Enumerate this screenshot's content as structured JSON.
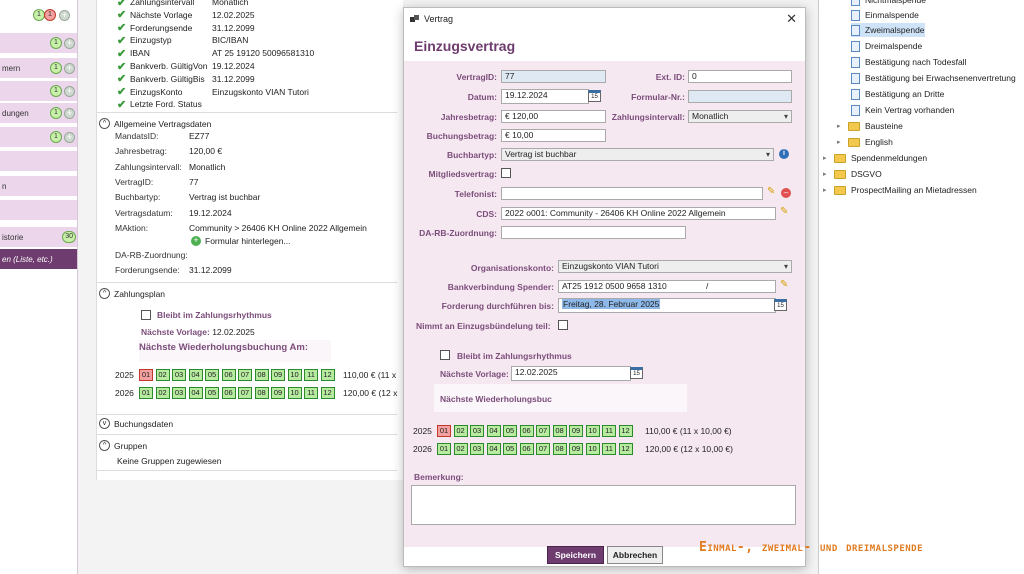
{
  "sidebar": {
    "badges": {
      "first": "1",
      "second": "1"
    },
    "items": [
      {
        "label": "",
        "count": "1"
      },
      {
        "label": "mern",
        "count": "1"
      },
      {
        "label": "",
        "count": "1"
      },
      {
        "label": "dungen",
        "count": "1"
      },
      {
        "label": "",
        "count": "1"
      },
      {
        "label": "",
        "count": ""
      },
      {
        "label": "n",
        "count": ""
      },
      {
        "label": "",
        "count": ""
      },
      {
        "label": "istorie",
        "count": "30"
      },
      {
        "label": "en (Liste, etc.)",
        "count": ""
      }
    ]
  },
  "contract_status": [
    {
      "label": "Zahlungsintervall",
      "value": "Monatlich"
    },
    {
      "label": "Nächste Vorlage",
      "value": "12.02.2025"
    },
    {
      "label": "Forderungsende",
      "value": "31.12.2099"
    },
    {
      "label": "Einzugstyp",
      "value": "BIC/IBAN"
    },
    {
      "label": "IBAN",
      "value": "AT 25 19120 50096581310"
    },
    {
      "label": "Bankverb. GültigVon",
      "value": "19.12.2024"
    },
    {
      "label": "Bankverb. GültigBis",
      "value": "31.12.2099"
    },
    {
      "label": "EinzugsKonto",
      "value": "Einzugskonto VIAN Tutori"
    },
    {
      "label": "Letzte Ford. Status",
      "value": ""
    }
  ],
  "general": {
    "title": "Allgemeine Vertragsdaten",
    "rows": [
      {
        "label": "MandatsID:",
        "value": "EZ77"
      },
      {
        "label": "Jahresbetrag:",
        "value": "120,00 €"
      },
      {
        "label": "Zahlungsintervall:",
        "value": "Monatlich"
      },
      {
        "label": "VertragID:",
        "value": "77"
      },
      {
        "label": "Buchbartyp:",
        "value": "Vertrag ist buchbar"
      },
      {
        "label": "Vertragsdatum:",
        "value": "19.12.2024"
      },
      {
        "label": "MAktion:",
        "value": "Community  >  26406 KH Online 2022 Allgemein"
      }
    ],
    "form_link": "Formular hinterlegen...",
    "rows2": [
      {
        "label": "DA-RB-Zuordnung:",
        "value": ""
      },
      {
        "label": "Forderungsende:",
        "value": "31.12.2099"
      }
    ]
  },
  "zahlungsplan": {
    "title": "Zahlungsplan",
    "rhythm_label": "Bleibt im Zahlungsrhythmus",
    "next_label": "Nächste Vorlage:",
    "next_value": "12.02.2025",
    "repeat_label": "Nächste Wiederholungsbuchung Am:",
    "years": [
      {
        "year": "2025",
        "summary": "110,00 € (11 x",
        "red": [
          "01"
        ]
      },
      {
        "year": "2026",
        "summary": "120,00 € (12 x",
        "red": []
      }
    ]
  },
  "months": [
    "01",
    "02",
    "03",
    "04",
    "05",
    "06",
    "07",
    "08",
    "09",
    "10",
    "11",
    "12"
  ],
  "buchungsdaten": {
    "title": "Buchungsdaten"
  },
  "gruppen": {
    "title": "Gruppen",
    "empty": "Keine Gruppen zugewiesen"
  },
  "dialog": {
    "window_title": "Vertrag",
    "heading": "Einzugsvertrag",
    "vertragid_label": "VertragID:",
    "vertragid_value": "77",
    "extid_label": "Ext. ID:",
    "extid_value": "0",
    "datum_label": "Datum:",
    "datum_value": "19.12.2024",
    "formular_label": "Formular-Nr.:",
    "formular_value": "",
    "jahresbetrag_label": "Jahresbetrag:",
    "jahresbetrag_value": "€ 120,00",
    "intervall_label": "Zahlungsintervall:",
    "intervall_value": "Monatlich",
    "buchungsbetrag_label": "Buchungsbetrag:",
    "buchungsbetrag_value": "€ 10,00",
    "buchbartyp_label": "Buchbartyp:",
    "buchbartyp_value": "Vertrag ist buchbar",
    "mitglied_label": "Mitgliedsvertrag:",
    "telefonist_label": "Telefonist:",
    "telefonist_value": "",
    "cds_label": "CDS:",
    "cds_value": "2022 o001: Community - 26406 KH Online 2022 Allgemein",
    "darb_label": "DA-RB-Zuordnung:",
    "darb_value": "",
    "orgkonto_label": "Organisationskonto:",
    "orgkonto_value": "Einzugskonto VIAN Tutori",
    "bank_label": "Bankverbindung Spender:",
    "bank_value": "AT25 1912 0500 9658 1310",
    "bank_slash": "/",
    "forderung_label": "Forderung durchführen bis:",
    "forderung_value": "Freitag, 28. Februar 2025",
    "buendelung_label": "Nimmt an Einzugsbündelung teil:",
    "rhythm_label": "Bleibt im Zahlungsrhythmus",
    "next_label": "Nächste Vorlage:",
    "next_value": "12.02.2025",
    "repeat_label": "Nächste Wiederholungsbuc",
    "years": [
      {
        "year": "2025",
        "summary": "110,00 € (11 x 10,00 €)",
        "red": [
          "01"
        ]
      },
      {
        "year": "2026",
        "summary": "120,00 € (12 x 10,00 €)",
        "red": []
      }
    ],
    "bemerkung_label": "Bemerkung:",
    "save_label": "Speichern",
    "cancel_label": "Abbrechen"
  },
  "tree": {
    "items": [
      {
        "type": "doc",
        "label": "Nichtmalspende",
        "indent": 2
      },
      {
        "type": "doc",
        "label": "Einmalspende",
        "indent": 2
      },
      {
        "type": "doc",
        "label": "Zweimalspende",
        "indent": 2,
        "selected": true
      },
      {
        "type": "doc",
        "label": "Dreimalspende",
        "indent": 2
      },
      {
        "type": "doc",
        "label": "Bestätigung nach Todesfall",
        "indent": 2
      },
      {
        "type": "doc",
        "label": "Bestätigung bei Erwachsenenvertretung",
        "indent": 2
      },
      {
        "type": "doc",
        "label": "Bestätigung an Dritte",
        "indent": 2
      },
      {
        "type": "doc",
        "label": "Kein Vertrag vorhanden",
        "indent": 2
      },
      {
        "type": "folder",
        "label": "Bausteine",
        "indent": 1
      },
      {
        "type": "folder",
        "label": "English",
        "indent": 1
      },
      {
        "type": "folder",
        "label": "Spendenmeldungen",
        "indent": 0
      },
      {
        "type": "folder",
        "label": "DSGVO",
        "indent": 0
      },
      {
        "type": "folder",
        "label": "ProspectMailing an Mietadressen",
        "indent": 0
      }
    ]
  },
  "caption": "Einmal-, zweimal- und dreimalspende"
}
